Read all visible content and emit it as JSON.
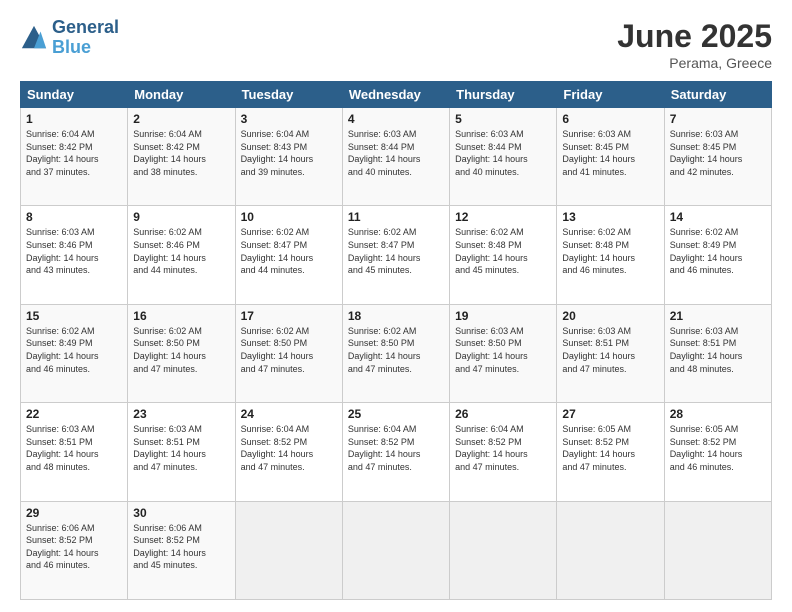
{
  "logo": {
    "line1": "General",
    "line2": "Blue"
  },
  "header": {
    "month_year": "June 2025",
    "location": "Perama, Greece"
  },
  "weekdays": [
    "Sunday",
    "Monday",
    "Tuesday",
    "Wednesday",
    "Thursday",
    "Friday",
    "Saturday"
  ],
  "weeks": [
    [
      {
        "day": "1",
        "info": "Sunrise: 6:04 AM\nSunset: 8:42 PM\nDaylight: 14 hours\nand 37 minutes."
      },
      {
        "day": "2",
        "info": "Sunrise: 6:04 AM\nSunset: 8:42 PM\nDaylight: 14 hours\nand 38 minutes."
      },
      {
        "day": "3",
        "info": "Sunrise: 6:04 AM\nSunset: 8:43 PM\nDaylight: 14 hours\nand 39 minutes."
      },
      {
        "day": "4",
        "info": "Sunrise: 6:03 AM\nSunset: 8:44 PM\nDaylight: 14 hours\nand 40 minutes."
      },
      {
        "day": "5",
        "info": "Sunrise: 6:03 AM\nSunset: 8:44 PM\nDaylight: 14 hours\nand 40 minutes."
      },
      {
        "day": "6",
        "info": "Sunrise: 6:03 AM\nSunset: 8:45 PM\nDaylight: 14 hours\nand 41 minutes."
      },
      {
        "day": "7",
        "info": "Sunrise: 6:03 AM\nSunset: 8:45 PM\nDaylight: 14 hours\nand 42 minutes."
      }
    ],
    [
      {
        "day": "8",
        "info": "Sunrise: 6:03 AM\nSunset: 8:46 PM\nDaylight: 14 hours\nand 43 minutes."
      },
      {
        "day": "9",
        "info": "Sunrise: 6:02 AM\nSunset: 8:46 PM\nDaylight: 14 hours\nand 44 minutes."
      },
      {
        "day": "10",
        "info": "Sunrise: 6:02 AM\nSunset: 8:47 PM\nDaylight: 14 hours\nand 44 minutes."
      },
      {
        "day": "11",
        "info": "Sunrise: 6:02 AM\nSunset: 8:47 PM\nDaylight: 14 hours\nand 45 minutes."
      },
      {
        "day": "12",
        "info": "Sunrise: 6:02 AM\nSunset: 8:48 PM\nDaylight: 14 hours\nand 45 minutes."
      },
      {
        "day": "13",
        "info": "Sunrise: 6:02 AM\nSunset: 8:48 PM\nDaylight: 14 hours\nand 46 minutes."
      },
      {
        "day": "14",
        "info": "Sunrise: 6:02 AM\nSunset: 8:49 PM\nDaylight: 14 hours\nand 46 minutes."
      }
    ],
    [
      {
        "day": "15",
        "info": "Sunrise: 6:02 AM\nSunset: 8:49 PM\nDaylight: 14 hours\nand 46 minutes."
      },
      {
        "day": "16",
        "info": "Sunrise: 6:02 AM\nSunset: 8:50 PM\nDaylight: 14 hours\nand 47 minutes."
      },
      {
        "day": "17",
        "info": "Sunrise: 6:02 AM\nSunset: 8:50 PM\nDaylight: 14 hours\nand 47 minutes."
      },
      {
        "day": "18",
        "info": "Sunrise: 6:02 AM\nSunset: 8:50 PM\nDaylight: 14 hours\nand 47 minutes."
      },
      {
        "day": "19",
        "info": "Sunrise: 6:03 AM\nSunset: 8:50 PM\nDaylight: 14 hours\nand 47 minutes."
      },
      {
        "day": "20",
        "info": "Sunrise: 6:03 AM\nSunset: 8:51 PM\nDaylight: 14 hours\nand 47 minutes."
      },
      {
        "day": "21",
        "info": "Sunrise: 6:03 AM\nSunset: 8:51 PM\nDaylight: 14 hours\nand 48 minutes."
      }
    ],
    [
      {
        "day": "22",
        "info": "Sunrise: 6:03 AM\nSunset: 8:51 PM\nDaylight: 14 hours\nand 48 minutes."
      },
      {
        "day": "23",
        "info": "Sunrise: 6:03 AM\nSunset: 8:51 PM\nDaylight: 14 hours\nand 47 minutes."
      },
      {
        "day": "24",
        "info": "Sunrise: 6:04 AM\nSunset: 8:52 PM\nDaylight: 14 hours\nand 47 minutes."
      },
      {
        "day": "25",
        "info": "Sunrise: 6:04 AM\nSunset: 8:52 PM\nDaylight: 14 hours\nand 47 minutes."
      },
      {
        "day": "26",
        "info": "Sunrise: 6:04 AM\nSunset: 8:52 PM\nDaylight: 14 hours\nand 47 minutes."
      },
      {
        "day": "27",
        "info": "Sunrise: 6:05 AM\nSunset: 8:52 PM\nDaylight: 14 hours\nand 47 minutes."
      },
      {
        "day": "28",
        "info": "Sunrise: 6:05 AM\nSunset: 8:52 PM\nDaylight: 14 hours\nand 46 minutes."
      }
    ],
    [
      {
        "day": "29",
        "info": "Sunrise: 6:06 AM\nSunset: 8:52 PM\nDaylight: 14 hours\nand 46 minutes."
      },
      {
        "day": "30",
        "info": "Sunrise: 6:06 AM\nSunset: 8:52 PM\nDaylight: 14 hours\nand 45 minutes."
      },
      {
        "day": "",
        "info": ""
      },
      {
        "day": "",
        "info": ""
      },
      {
        "day": "",
        "info": ""
      },
      {
        "day": "",
        "info": ""
      },
      {
        "day": "",
        "info": ""
      }
    ]
  ]
}
